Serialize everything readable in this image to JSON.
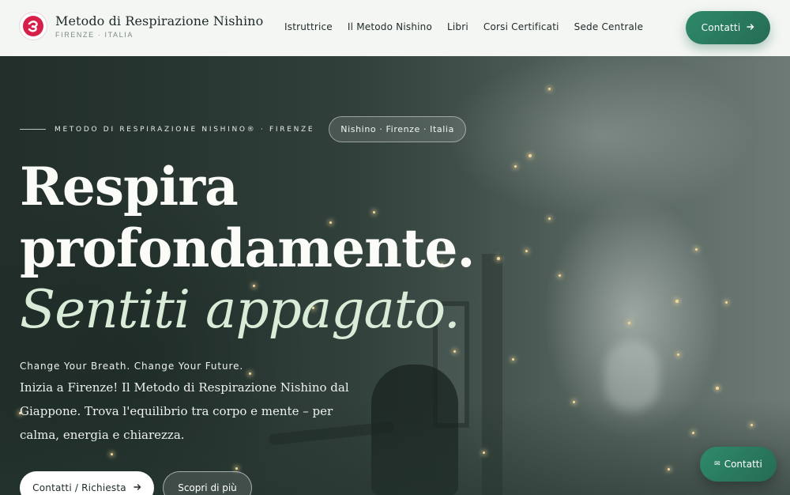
{
  "brand": {
    "title": "Metodo di Respirazione Nishino",
    "subtitle": "FIRENZE · ITALIA",
    "logo_icon": "brand-logo-icon"
  },
  "nav": {
    "items": [
      "Istruttrice",
      "Il Metodo Nishino",
      "Libri",
      "Corsi Certificati",
      "Sede Centrale"
    ]
  },
  "header_cta": {
    "label": "Contatti",
    "icon": "arrow-right-icon"
  },
  "hero": {
    "eyebrow": "METODO DI RESPIRAZIONE NISHINO® · FIRENZE",
    "chip": "Nishino · Firenze · Italia",
    "headline_line1": "Respira",
    "headline_line2": "profondamente.",
    "headline_italic": "Sentiti appagato.",
    "tagline": "Change Your Breath. Change Your Future.",
    "lead": "Inizia a Firenze! Il Metodo di Respirazione Nishino dal Giappone. Trova l'equilibrio tra corpo e mente – per calma, energia e chiarezza.",
    "primary_button": "Contatti / Richiesta",
    "secondary_button": "Scopri di più"
  },
  "floating_cta": {
    "label": "Contatti",
    "icon": "mail-icon"
  },
  "colors": {
    "accent": "#2f8a6a",
    "accent_dark": "#256b55",
    "italic_headline": "#d9ecd8",
    "logo": "#d6204a",
    "header_bg": "#f4f6f3"
  }
}
